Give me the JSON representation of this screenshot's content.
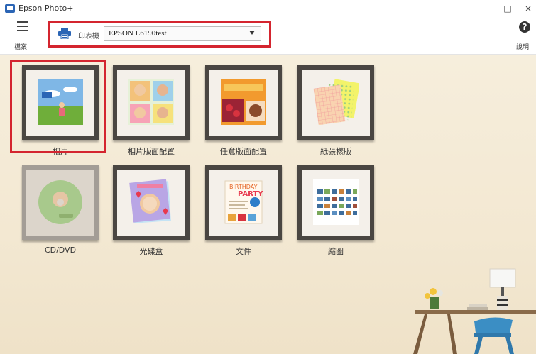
{
  "window": {
    "title": "Epson Photo+",
    "minimize": "–",
    "maximize": "□",
    "close": "×"
  },
  "toolbar": {
    "menu_label": "檔案",
    "printer_label": "印表機",
    "printer_value": "EPSON L6190test",
    "help_label": "說明",
    "help_glyph": "?"
  },
  "tiles": [
    {
      "label": "相片",
      "icon": "photo-icon",
      "selected": true
    },
    {
      "label": "相片版面配置",
      "icon": "photo-layout-icon"
    },
    {
      "label": "任意版面配置",
      "icon": "free-layout-icon"
    },
    {
      "label": "紙張樣版",
      "icon": "paper-template-icon"
    },
    {
      "label": "CD/DVD",
      "icon": "cd-dvd-icon",
      "faded": true
    },
    {
      "label": "光碟盒",
      "icon": "disc-case-icon"
    },
    {
      "label": "文件",
      "icon": "document-icon"
    },
    {
      "label": "縮圖",
      "icon": "thumbnails-icon"
    }
  ],
  "artwork": {
    "birthday_line1": "BIRTHDAY",
    "birthday_line2": "PARTY"
  },
  "colors": {
    "accent_red": "#d4252f",
    "printer_blue": "#2b65b5",
    "background": "#f4ead6"
  }
}
